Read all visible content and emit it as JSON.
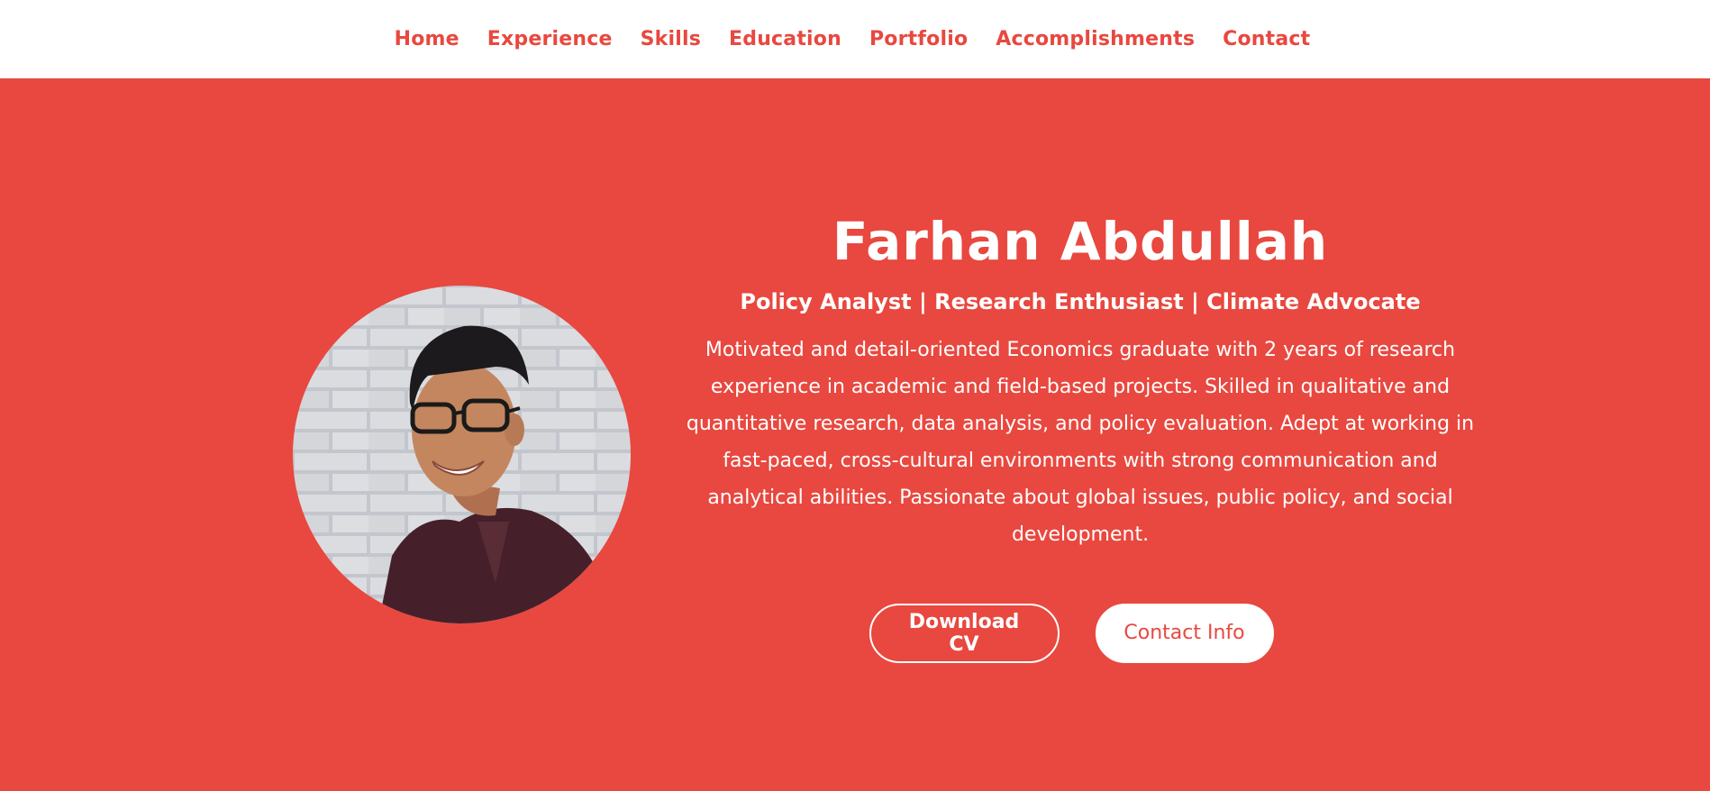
{
  "nav": {
    "items": [
      {
        "label": "Home"
      },
      {
        "label": "Experience"
      },
      {
        "label": "Skills"
      },
      {
        "label": "Education"
      },
      {
        "label": "Portfolio"
      },
      {
        "label": "Accomplishments"
      },
      {
        "label": "Contact"
      }
    ]
  },
  "hero": {
    "name": "Farhan Abdullah",
    "tagline": "Policy Analyst | Research Enthusiast | Climate Advocate",
    "bio": "Motivated and detail-oriented Economics graduate with 2 years of research experience in academic and field-based projects. Skilled in qualitative and quantitative research, data analysis, and policy evaluation. Adept at working in fast-paced, cross-cultural environments with strong communication and analytical abilities. Passionate about global issues, public policy, and social development.",
    "buttons": {
      "download_cv": "Download CV",
      "contact_info": "Contact Info"
    }
  },
  "colors": {
    "accent": "#e8483f",
    "nav_background": "#ffffff",
    "text_on_accent": "#ffffff"
  }
}
